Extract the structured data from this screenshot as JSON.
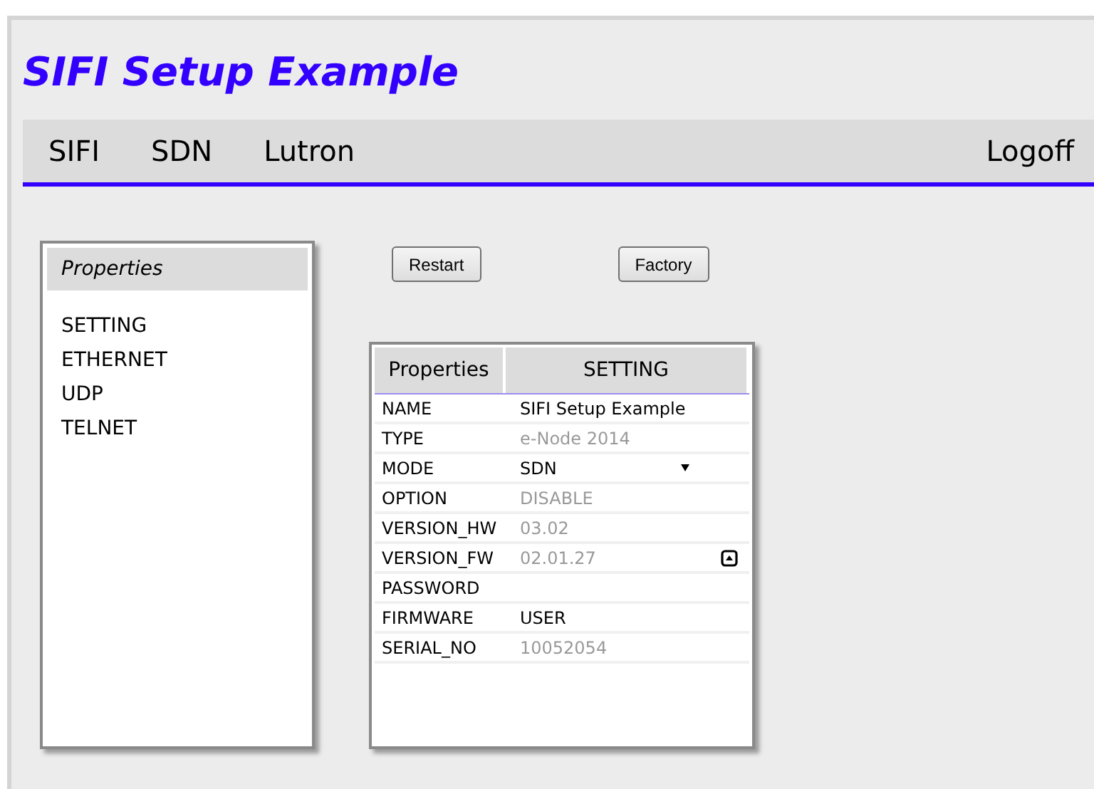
{
  "title": "SIFI Setup Example",
  "nav": {
    "items": [
      {
        "label": "SIFI"
      },
      {
        "label": "SDN"
      },
      {
        "label": "Lutron"
      }
    ],
    "logoff": "Logoff"
  },
  "sidebar": {
    "heading": "Properties",
    "items": [
      {
        "label": "SETTING"
      },
      {
        "label": "ETHERNET"
      },
      {
        "label": "UDP"
      },
      {
        "label": "TELNET"
      }
    ]
  },
  "buttons": [
    "Restart",
    "Factory"
  ],
  "table": {
    "columns": [
      "Properties",
      "SETTING"
    ],
    "rows": [
      {
        "label": "NAME",
        "value": "SIFI Setup Example",
        "disabled": false,
        "kind": "text"
      },
      {
        "label": "TYPE",
        "value": "e-Node 2014",
        "disabled": true,
        "kind": "text"
      },
      {
        "label": "MODE",
        "value": "SDN",
        "disabled": false,
        "kind": "select"
      },
      {
        "label": "OPTION",
        "value": "DISABLE",
        "disabled": true,
        "kind": "text"
      },
      {
        "label": "VERSION_HW",
        "value": "03.02",
        "disabled": true,
        "kind": "text"
      },
      {
        "label": "VERSION_FW",
        "value": "02.01.27",
        "disabled": true,
        "kind": "upload"
      },
      {
        "label": "PASSWORD",
        "kind": "text"
      },
      {
        "label": "FIRMWARE",
        "value": "USER",
        "disabled": false,
        "kind": "text"
      },
      {
        "label": "SERIAL_NO",
        "value": "10052054",
        "disabled": true,
        "kind": "text"
      }
    ]
  }
}
